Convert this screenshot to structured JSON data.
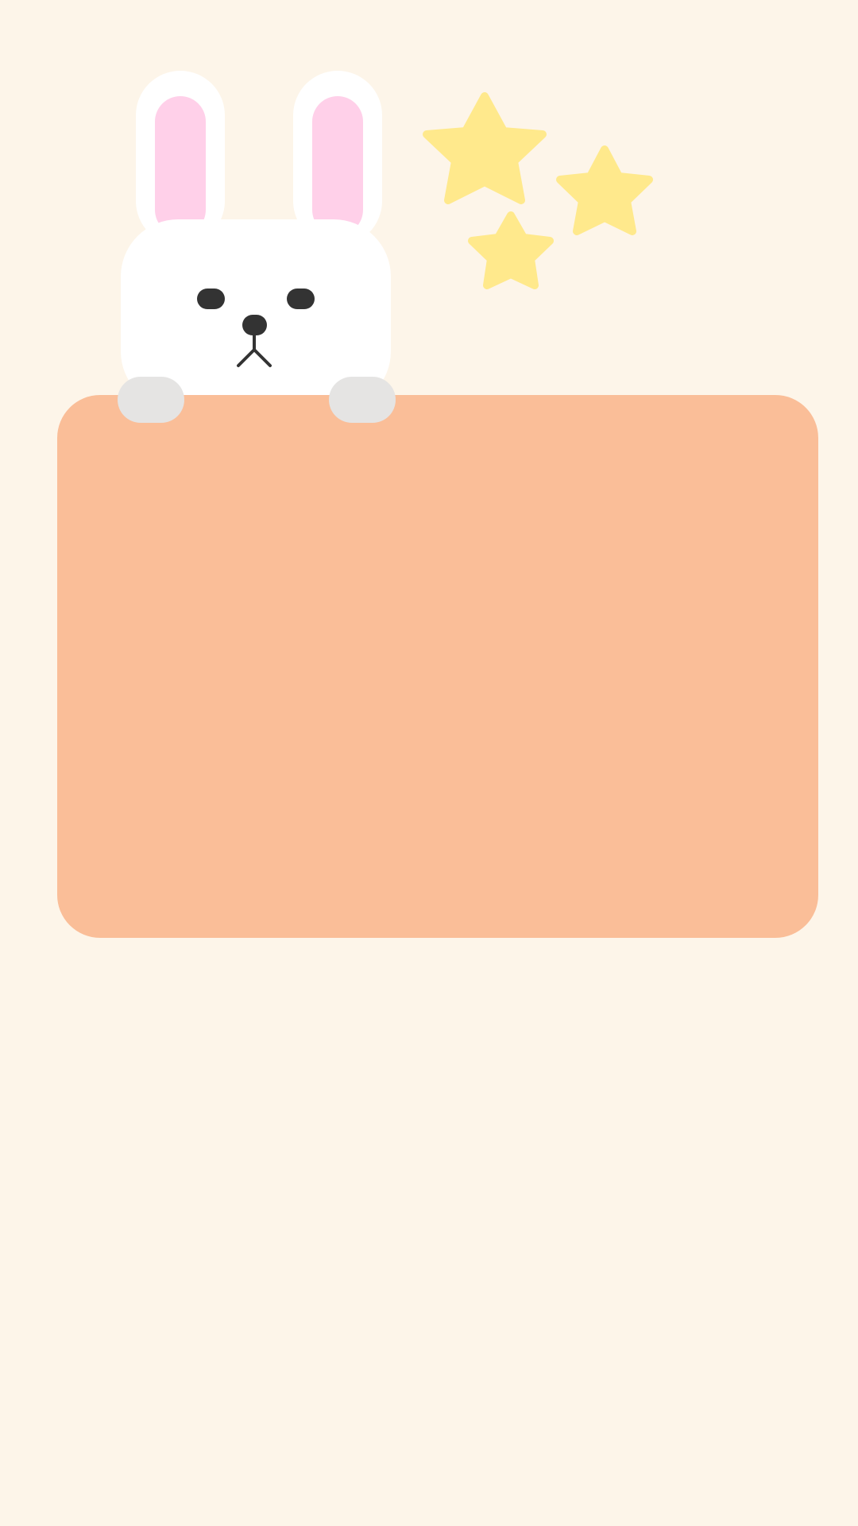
{
  "theme": {
    "background": "#FDF5E9",
    "card": "#FABE98",
    "bunny_fur": "#FFFFFF",
    "ear_inner": "#FFD0E9",
    "paws": "#E5E4E3",
    "face_features": "#333333",
    "stars": "#FFE98C"
  },
  "note_card": {
    "text": ""
  },
  "decorations": {
    "character": "bunny",
    "stars": [
      "star-icon",
      "star-icon",
      "star-icon"
    ]
  }
}
